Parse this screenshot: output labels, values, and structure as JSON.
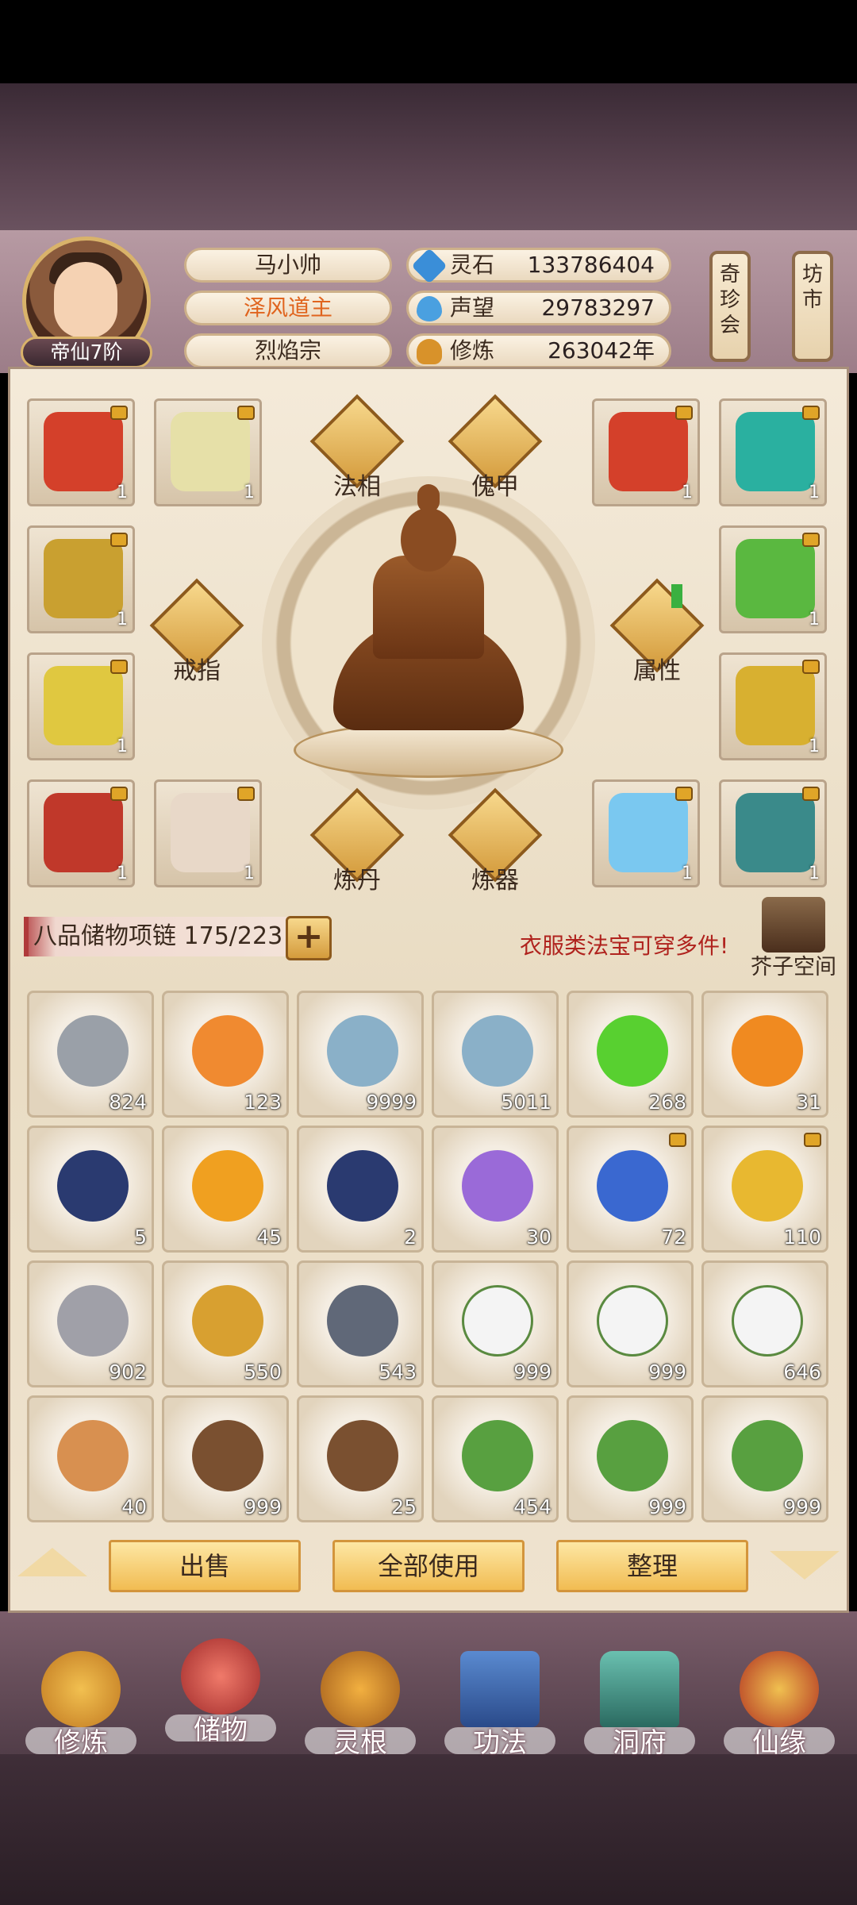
{
  "player": {
    "name": "马小帅",
    "title": "泽风道主",
    "sect": "烈焰宗",
    "rank": "帝仙7阶"
  },
  "stats": [
    {
      "label": "灵石",
      "value": "133786404",
      "icon": "spirit-stone-icon",
      "color": "#3a8ed8"
    },
    {
      "label": "声望",
      "value": "29783297",
      "icon": "reputation-crystal-icon",
      "color": "#4aa0e0"
    },
    {
      "label": "修炼",
      "value": "263042年",
      "icon": "meditation-icon",
      "color": "#d8922a"
    }
  ],
  "side_buttons": {
    "treasure_fair": "奇珍会",
    "market": "坊市"
  },
  "functions": {
    "faxiang": "法相",
    "kuijia": "傀甲",
    "ring": "戒指",
    "attributes": "属性",
    "alchemy": "炼丹",
    "forging": "炼器"
  },
  "equipment": [
    {
      "count": "1",
      "color": "#d4402a",
      "locked": true
    },
    {
      "count": "1",
      "color": "#e6e0a8",
      "locked": true
    },
    {
      "count": "1",
      "color": "#d4402a",
      "locked": true
    },
    {
      "count": "1",
      "color": "#2ab0a0",
      "locked": true
    },
    {
      "count": "1",
      "color": "#c9a030",
      "locked": true
    },
    {
      "count": "1",
      "color": "#5ab840",
      "locked": true
    },
    {
      "count": "1",
      "color": "#e0c840",
      "locked": true
    },
    {
      "count": "1",
      "color": "#d8b030",
      "locked": true
    },
    {
      "count": "1",
      "color": "#c0382a",
      "locked": true
    },
    {
      "count": "1",
      "color": "#e8d8c8",
      "locked": true
    },
    {
      "count": "1",
      "color": "#7ac8f0",
      "locked": true
    },
    {
      "count": "1",
      "color": "#3a8a8a",
      "locked": true
    }
  ],
  "storage": {
    "label": "八品储物项链 175/223",
    "expand": "+",
    "tip": "衣服类法宝可穿多件!",
    "mustard_space": "芥子空间"
  },
  "inventory": [
    {
      "qty": "824",
      "color": "#9aa0a8",
      "icon": "iron-shards-icon",
      "locked": false
    },
    {
      "qty": "123",
      "color": "#f08a30",
      "icon": "amber-shards-icon",
      "locked": false
    },
    {
      "qty": "9999",
      "color": "#8ab0c8",
      "icon": "spirit-orb-icon",
      "locked": false
    },
    {
      "qty": "5011",
      "color": "#8ab0c8",
      "icon": "spirit-orb-icon",
      "locked": false
    },
    {
      "qty": "268",
      "color": "#58d030",
      "icon": "green-orb-icon",
      "locked": false
    },
    {
      "qty": "31",
      "color": "#f08a20",
      "icon": "flame-icon",
      "locked": false
    },
    {
      "qty": "5",
      "color": "#2a3a70",
      "icon": "dark-flame-icon",
      "locked": false
    },
    {
      "qty": "45",
      "color": "#f0a020",
      "icon": "flame-icon",
      "locked": false
    },
    {
      "qty": "2",
      "color": "#2a3a70",
      "icon": "dark-flame-icon",
      "locked": false
    },
    {
      "qty": "30",
      "color": "#9a6ad8",
      "icon": "purple-cloud-icon",
      "locked": false
    },
    {
      "qty": "72",
      "color": "#3a68d0",
      "icon": "blue-gourd-icon",
      "locked": true
    },
    {
      "qty": "110",
      "color": "#e8b830",
      "icon": "golden-gourd-icon",
      "locked": true
    },
    {
      "qty": "902",
      "color": "#a0a0a8",
      "icon": "silver-ore-icon",
      "locked": false
    },
    {
      "qty": "550",
      "color": "#d8a030",
      "icon": "gold-ore-icon",
      "locked": false
    },
    {
      "qty": "543",
      "color": "#606878",
      "icon": "dark-ore-icon",
      "locked": false
    },
    {
      "qty": "999",
      "color": "#f4f4f4",
      "icon": "white-lily-icon",
      "locked": false
    },
    {
      "qty": "999",
      "color": "#f4f4f4",
      "icon": "white-lily-icon",
      "locked": false
    },
    {
      "qty": "646",
      "color": "#f4f4f4",
      "icon": "white-lily-icon",
      "locked": false
    },
    {
      "qty": "40",
      "color": "#d89050",
      "icon": "ginseng-icon",
      "locked": false
    },
    {
      "qty": "999",
      "color": "#7a5030",
      "icon": "herb-root-icon",
      "locked": false
    },
    {
      "qty": "25",
      "color": "#7a5030",
      "icon": "herb-root-icon",
      "locked": false
    },
    {
      "qty": "454",
      "color": "#58a040",
      "icon": "red-flower-herb-icon",
      "locked": false
    },
    {
      "qty": "999",
      "color": "#58a040",
      "icon": "red-flower-herb-icon",
      "locked": false
    },
    {
      "qty": "999",
      "color": "#58a040",
      "icon": "red-flower-herb-icon",
      "locked": false
    }
  ],
  "actions": {
    "sell": "出售",
    "use_all": "全部使用",
    "organize": "整理"
  },
  "nav": [
    {
      "label": "修炼",
      "icon": "cultivation-nav-icon",
      "color": "#e8a030"
    },
    {
      "label": "储物",
      "icon": "storage-bag-nav-icon",
      "color": "#d04a3a"
    },
    {
      "label": "灵根",
      "icon": "spirit-root-nav-icon",
      "color": "#e89830"
    },
    {
      "label": "功法",
      "icon": "technique-book-nav-icon",
      "color": "#3a6ab0"
    },
    {
      "label": "洞府",
      "icon": "cave-abode-nav-icon",
      "color": "#3a9a8a"
    },
    {
      "label": "仙缘",
      "icon": "immortal-fate-nav-icon",
      "color": "#c0302a"
    }
  ]
}
